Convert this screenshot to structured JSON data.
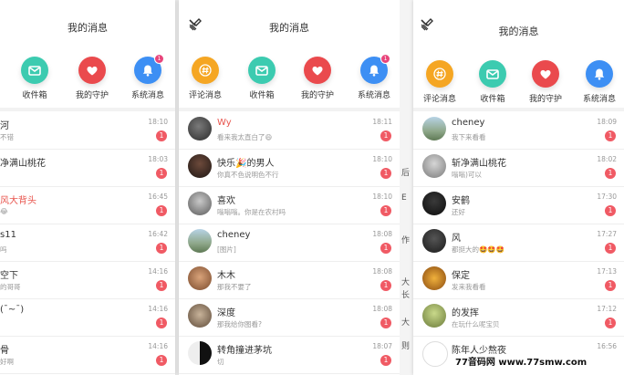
{
  "colors": {
    "accent_red": "#e8554e",
    "badge": "#f05a64",
    "orange": "#f5a623",
    "green": "#3ccbb0",
    "red": "#ea4a4d",
    "blue": "#3d8ff4"
  },
  "panel_a": {
    "title": "我的消息",
    "tabs": [
      {
        "label": "收件箱",
        "icon": "mail-icon"
      },
      {
        "label": "我的守护",
        "icon": "heart-icon"
      },
      {
        "label": "系统消息",
        "icon": "bell-icon",
        "dot": "1"
      }
    ],
    "rows": [
      {
        "name": "河",
        "preview": "不错",
        "time": "18:10",
        "badge": "1",
        "red": false
      },
      {
        "name": "净满山桃花",
        "preview": "",
        "time": "18:03",
        "badge": "1",
        "red": false
      },
      {
        "name": "风大背头",
        "preview": "😂",
        "time": "16:45",
        "badge": "1",
        "red": true
      },
      {
        "name": "s11",
        "preview": "吗",
        "time": "16:42",
        "badge": "1",
        "red": false
      },
      {
        "name": "空下",
        "preview": "的哥哥",
        "time": "14:16",
        "badge": "1",
        "red": false
      },
      {
        "name": "(¯~¯)",
        "preview": "",
        "time": "14:16",
        "badge": "1",
        "red": false
      },
      {
        "name": "骨",
        "preview": "好啊",
        "time": "14:16",
        "badge": "1",
        "red": false
      }
    ]
  },
  "panel_b": {
    "title": "我的消息",
    "tabs": [
      {
        "label": "评论消息",
        "icon": "hash-icon"
      },
      {
        "label": "收件箱",
        "icon": "mail-icon"
      },
      {
        "label": "我的守护",
        "icon": "heart-icon"
      },
      {
        "label": "系统消息",
        "icon": "bell-icon",
        "dot": "1"
      }
    ],
    "rows": [
      {
        "name": "Wy",
        "preview": "看来我太直白了😄",
        "time": "18:11",
        "badge": "1",
        "red": true
      },
      {
        "name": "快乐🎉的男人",
        "preview": "你真不色说明色不行",
        "time": "18:10",
        "badge": "1",
        "red": false
      },
      {
        "name": "喜欢",
        "preview": "嗡嗡嗡。你是在农村吗",
        "time": "18:10",
        "badge": "1",
        "red": false
      },
      {
        "name": "cheney",
        "preview": "[图片]",
        "time": "18:08",
        "badge": "1",
        "red": false
      },
      {
        "name": "木木",
        "preview": "那我不要了",
        "time": "18:08",
        "badge": "1",
        "red": false
      },
      {
        "name": "深度",
        "preview": "那我给你图看?",
        "time": "18:08",
        "badge": "1",
        "red": false
      },
      {
        "name": "转角撞进茅坑",
        "preview": "切",
        "time": "18:07",
        "badge": "1",
        "red": false
      }
    ]
  },
  "strip": {
    "texts": [
      "后",
      "E",
      "作",
      "大",
      "长",
      "大",
      "则"
    ]
  },
  "panel_c": {
    "title": "我的消息",
    "tabs": [
      {
        "label": "评论消息",
        "icon": "hash-icon"
      },
      {
        "label": "收件箱",
        "icon": "mail-icon"
      },
      {
        "label": "我的守护",
        "icon": "heart-icon"
      },
      {
        "label": "系统消息",
        "icon": "bell-icon"
      }
    ],
    "rows": [
      {
        "name": "cheney",
        "preview": "我下来看看",
        "time": "18:09",
        "badge": "1",
        "red": false
      },
      {
        "name": "斩净满山桃花",
        "preview": "嗡嗡)可以",
        "time": "18:02",
        "badge": "1",
        "red": false
      },
      {
        "name": "安鹤",
        "preview": "还好",
        "time": "17:30",
        "badge": "1",
        "red": false
      },
      {
        "name": "风",
        "preview": "都挺大的🤩🤩🤩",
        "time": "17:27",
        "badge": "1",
        "red": false
      },
      {
        "name": "保定",
        "preview": "发来我看看",
        "time": "17:13",
        "badge": "1",
        "red": false
      },
      {
        "name": "的发挥",
        "preview": "在玩什么呢宝贝",
        "time": "17:12",
        "badge": "1",
        "red": false
      },
      {
        "name": "陈年人少熬夜",
        "preview": "",
        "time": "16:56",
        "badge": "",
        "red": false
      }
    ]
  },
  "watermark": "77音码网  www.77smw.com"
}
